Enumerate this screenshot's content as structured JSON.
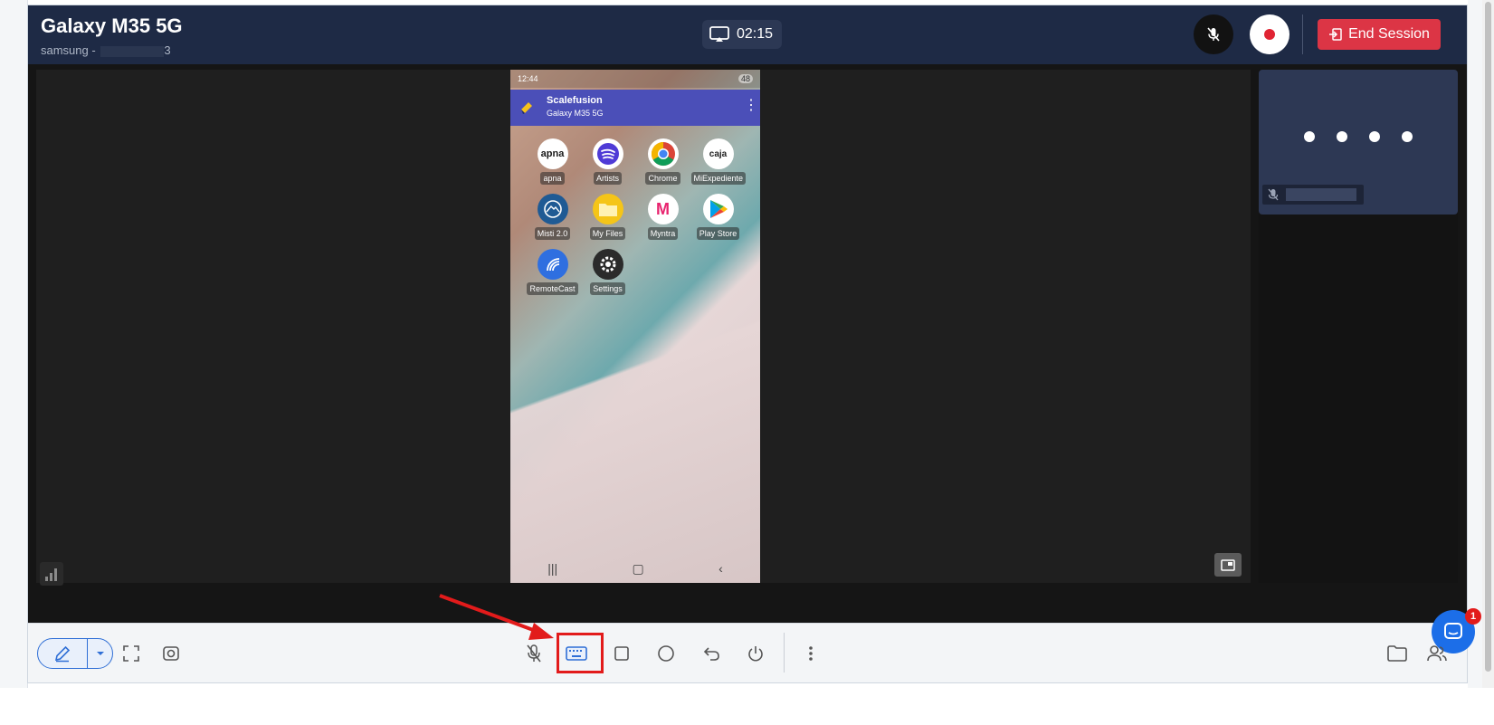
{
  "header": {
    "title": "Galaxy M35 5G",
    "subtitle_prefix": "samsung - ",
    "subtitle_visible_tail": "3",
    "timer": "02:15",
    "end_session_label": "End Session"
  },
  "phone": {
    "status_time": "12:44",
    "battery": "48",
    "app_name": "Scalefusion",
    "app_device": "Galaxy M35 5G",
    "apps": [
      {
        "label": "apna",
        "icon": "apna-icon",
        "glyph": "apna"
      },
      {
        "label": "Artists",
        "icon": "spotify-icon",
        "glyph": ""
      },
      {
        "label": "Chrome",
        "icon": "chrome-icon",
        "glyph": ""
      },
      {
        "label": "MiExpediente",
        "icon": "caja-icon",
        "glyph": "caja"
      },
      {
        "label": "Misti 2.0",
        "icon": "misti-icon",
        "glyph": ""
      },
      {
        "label": "My Files",
        "icon": "folder-icon",
        "glyph": ""
      },
      {
        "label": "Myntra",
        "icon": "myntra-icon",
        "glyph": "M"
      },
      {
        "label": "Play Store",
        "icon": "play-store-icon",
        "glyph": ""
      },
      {
        "label": "RemoteCast",
        "icon": "remotecast-icon",
        "glyph": ""
      },
      {
        "label": "Settings",
        "icon": "settings-icon",
        "glyph": ""
      }
    ]
  },
  "chat": {
    "badge_count": "1"
  },
  "colors": {
    "header_bg": "#1e2a45",
    "end_session": "#dc3545",
    "accent": "#2f6fd6",
    "annotation_red": "#e21b1b"
  }
}
